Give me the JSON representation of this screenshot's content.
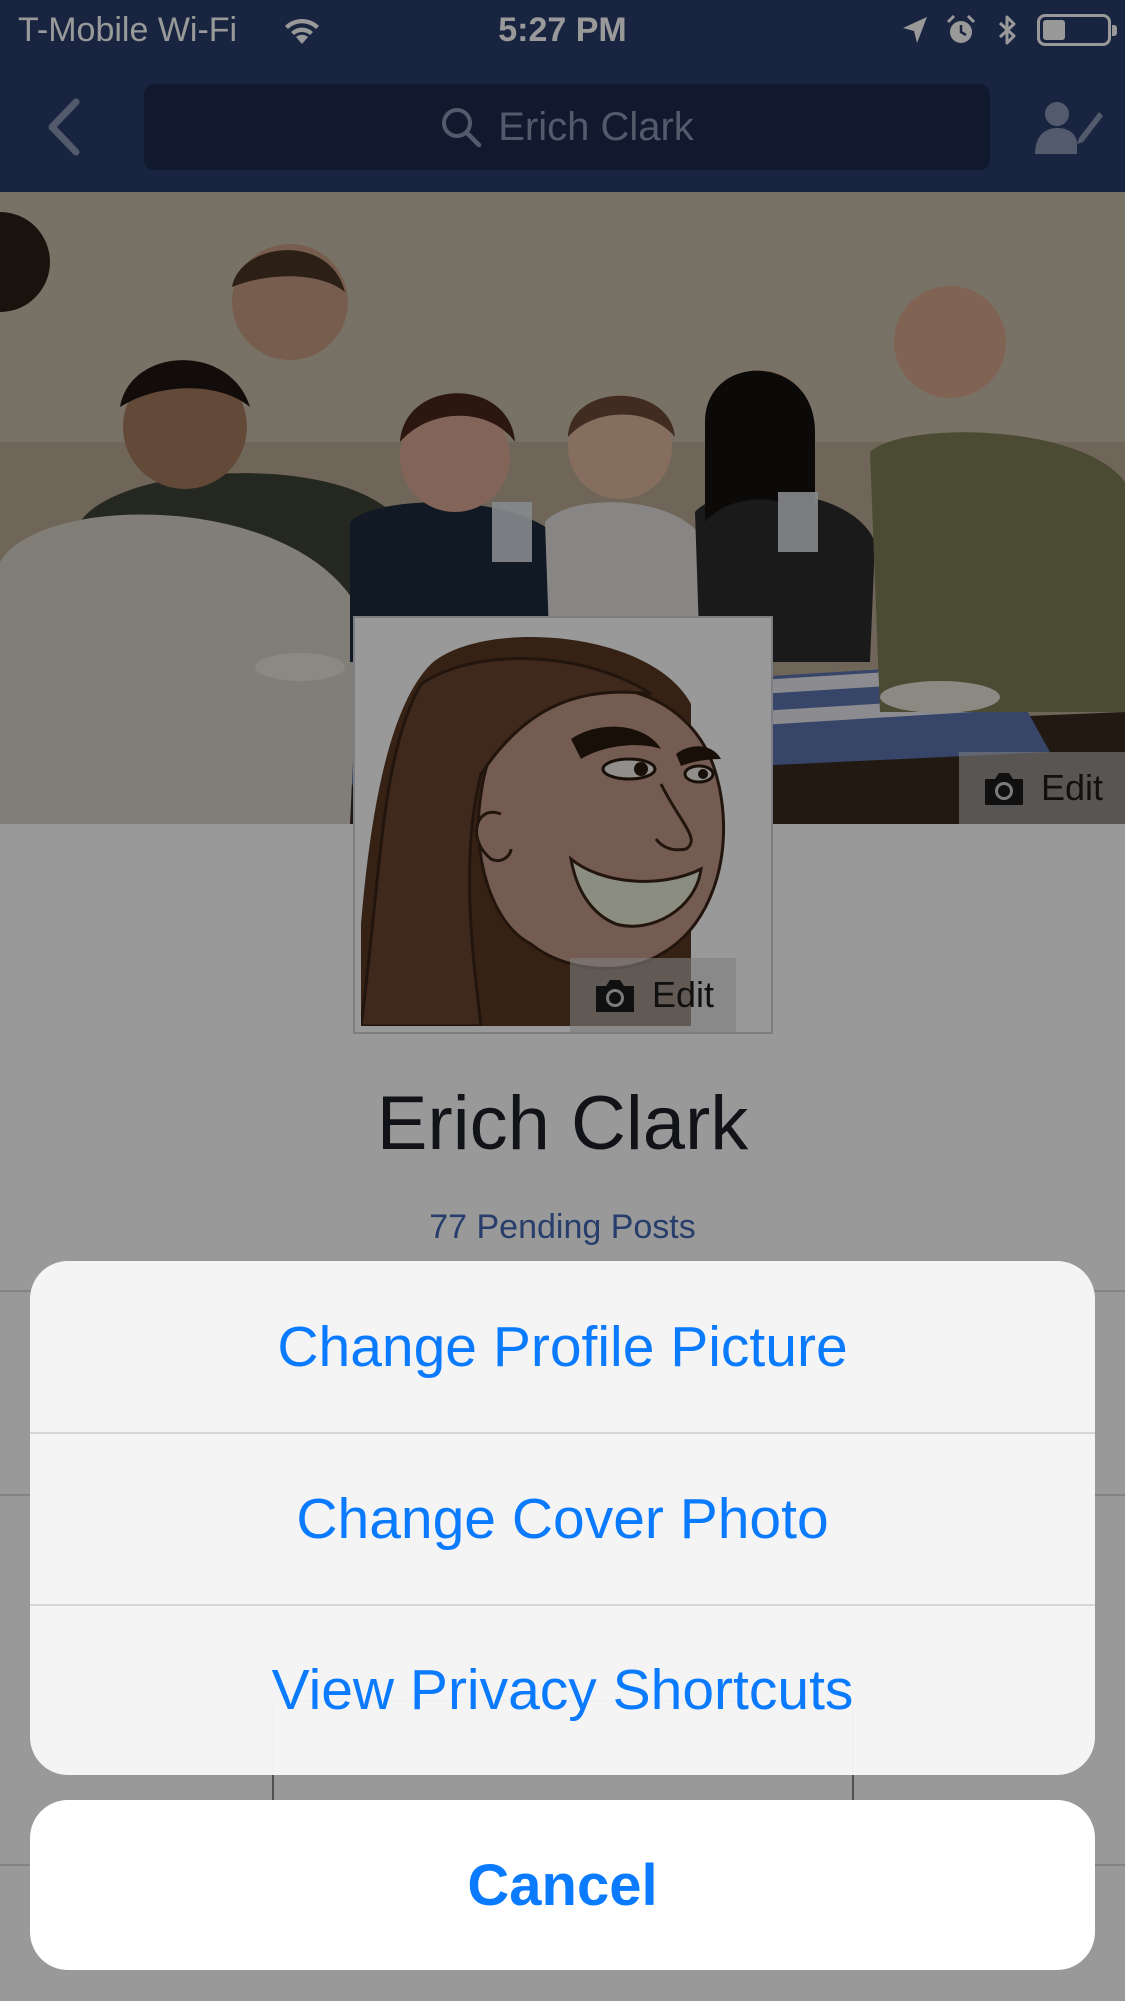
{
  "status_bar": {
    "carrier": "T-Mobile Wi-Fi",
    "time": "5:27 PM",
    "battery_level": 0.35,
    "icons": [
      "wifi-icon",
      "location-arrow-icon",
      "alarm-icon",
      "bluetooth-icon",
      "battery-icon"
    ]
  },
  "nav": {
    "search_value": "Erich Clark",
    "icons": [
      "back-chevron-icon",
      "search-icon",
      "edit-profile-icon"
    ]
  },
  "cover": {
    "edit_label": "Edit"
  },
  "profile": {
    "edit_label": "Edit",
    "name": "Erich Clark",
    "pending_posts": "77 Pending Posts"
  },
  "action_sheet": {
    "items": [
      "Change Profile Picture",
      "Change Cover Photo",
      "View Privacy Shortcuts"
    ],
    "cancel": "Cancel"
  },
  "colors": {
    "facebook_blue": "#3b5998",
    "ios_action_blue": "#0a7aff",
    "link_blue": "#4267b2"
  }
}
